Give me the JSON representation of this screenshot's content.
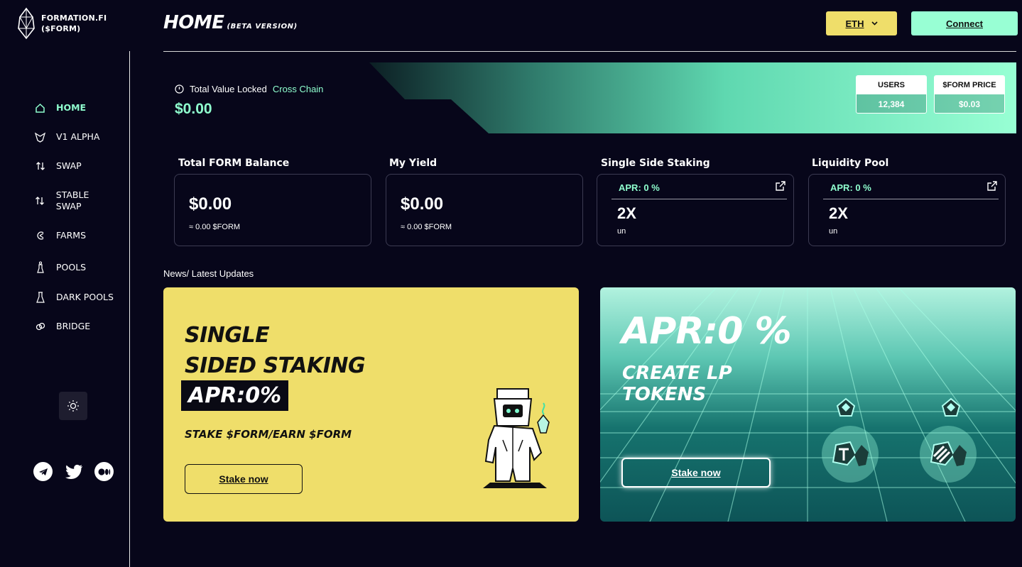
{
  "brand": {
    "name": "FORMATION.FI",
    "ticker": "($FORM)"
  },
  "nav": [
    {
      "label": "HOME",
      "icon": "home-icon",
      "active": true
    },
    {
      "label": "V1 ALPHA",
      "icon": "alpha-icon"
    },
    {
      "label": "SWAP",
      "icon": "swap-icon"
    },
    {
      "label": "STABLE SWAP",
      "icon": "swap-icon"
    },
    {
      "label": "FARMS",
      "icon": "farms-icon"
    },
    {
      "label": "POOLS",
      "icon": "pools-icon"
    },
    {
      "label": "DARK POOLS",
      "icon": "flask-icon"
    },
    {
      "label": "BRIDGE",
      "icon": "bridge-icon"
    }
  ],
  "header": {
    "title": "HOME",
    "subtitle": "(BETA VERSION)",
    "network": "ETH",
    "connect": "Connect"
  },
  "tvl": {
    "label": "Total Value Locked",
    "label_accent": "Cross Chain",
    "value": "$0.00",
    "users_label": "USERS",
    "users_value": "12,384",
    "price_label": "$FORM PRICE",
    "price_value": "$0.03"
  },
  "cards": {
    "balance": {
      "title": "Total FORM Balance",
      "value": "$0.00",
      "sub": "≈ 0.00 $FORM"
    },
    "yield": {
      "title": "My Yield",
      "value": "$0.00",
      "sub": "≈ 0.00 $FORM"
    },
    "staking": {
      "title": "Single Side Staking",
      "apr": "APR: 0 %",
      "mult": "2X",
      "unit": "un"
    },
    "liquidity": {
      "title": "Liquidity Pool",
      "apr": "APR: 0 %",
      "mult": "2X",
      "unit": "un"
    }
  },
  "news": {
    "title": "News/ Latest Updates"
  },
  "promo_staking": {
    "line1": "SINGLE",
    "line2": "SIDED STAKING",
    "apr": "APR:0%",
    "sub": "STAKE $FORM/EARN $FORM",
    "button": "Stake now"
  },
  "promo_lp": {
    "apr": "APR:0 %",
    "line1": "CREATE LP",
    "line2": "TOKENS",
    "button": "Stake now"
  },
  "colors": {
    "accent": "#8fffcf",
    "yellow": "#efde6a",
    "bg": "#07061a"
  }
}
